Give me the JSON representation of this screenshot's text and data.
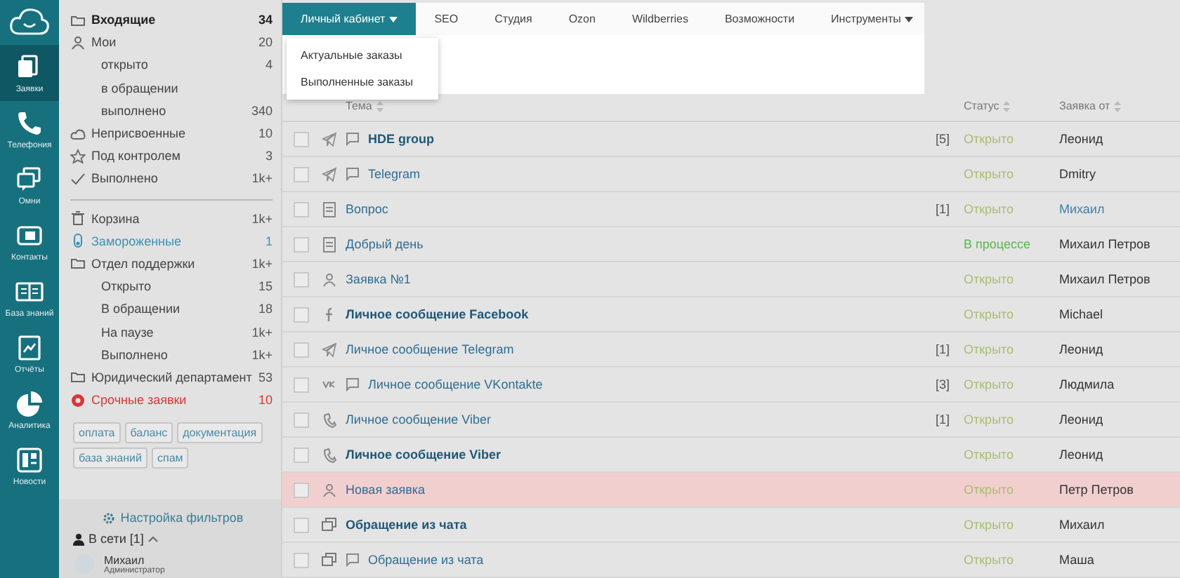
{
  "rail": {
    "items": [
      {
        "kind": "requests",
        "label": "Заявки",
        "selected": true
      },
      {
        "kind": "phone",
        "label": "Телефония",
        "selected": false
      },
      {
        "kind": "omni",
        "label": "Омни",
        "selected": false
      },
      {
        "kind": "contacts",
        "label": "Контакты",
        "selected": false
      },
      {
        "kind": "book",
        "label": "База знаний",
        "selected": false
      },
      {
        "kind": "report",
        "label": "Отчёты",
        "selected": false
      },
      {
        "kind": "pie",
        "label": "Аналитика",
        "selected": false
      },
      {
        "kind": "news",
        "label": "Новости",
        "selected": false
      }
    ]
  },
  "sidebar": {
    "sections": [
      {
        "items": [
          {
            "kind": "folder",
            "label": "Входящие",
            "count": "34",
            "bold": true
          },
          {
            "kind": "user",
            "label": "Мои",
            "count": "20",
            "bold": false,
            "children": [
              {
                "label": "открыто",
                "count": "4",
                "bold": false
              },
              {
                "label": "в обращении",
                "bold": false
              },
              {
                "label": "выполнено",
                "count": "340",
                "bold": false
              }
            ]
          },
          {
            "kind": "cloud",
            "label": "Неприсвоенные",
            "count": "10",
            "bold": false
          },
          {
            "kind": "star",
            "label": "Под контролем",
            "count": "3",
            "bold": false
          },
          {
            "kind": "check",
            "label": "Выполнено",
            "count": "1k+",
            "bold": false
          }
        ]
      },
      {
        "items": [
          {
            "kind": "trash",
            "label": "Корзина",
            "count": "1k+",
            "bold": false
          },
          {
            "kind": "frozen",
            "label": "Замороженные",
            "count": "1",
            "bold": false
          },
          {
            "kind": "folder",
            "label": "Отдел поддержки",
            "count": "1k+",
            "bold": false,
            "children": [
              {
                "label": "Открыто",
                "count": "15",
                "bold": false
              },
              {
                "label": "В обращении",
                "count": "18",
                "bold": false
              },
              {
                "label": "На паузе",
                "count": "1k+",
                "bold": false
              },
              {
                "label": "Выполнено",
                "count": "1k+",
                "bold": false
              }
            ]
          },
          {
            "kind": "folder",
            "label": "Юридический департамент",
            "count": "53",
            "bold": false
          },
          {
            "kind": "urgent",
            "label": "Срочные заявки",
            "count": "10",
            "bold": false
          }
        ]
      }
    ],
    "tags": [
      "оплата",
      "баланс",
      "документация",
      "база знаний",
      "спам"
    ],
    "filter_link": "Настройка фильтров",
    "online": {
      "label": "В сети [1]",
      "expanded": true
    },
    "user": {
      "name": "Михаил",
      "role": "Администратор"
    }
  },
  "nav": {
    "tabs": [
      {
        "label": "Личный кабинет",
        "selected": true,
        "dropdown": true
      },
      {
        "label": "SEO",
        "selected": false,
        "dropdown": false
      },
      {
        "label": "Студия",
        "selected": false,
        "dropdown": false
      },
      {
        "label": "Ozon",
        "selected": false,
        "dropdown": false
      },
      {
        "label": "Wildberries",
        "selected": false,
        "dropdown": false
      },
      {
        "label": "Возможности",
        "selected": false,
        "dropdown": false
      },
      {
        "label": "Инструменты",
        "selected": false,
        "dropdown": true
      }
    ],
    "menu": [
      "Актуальные заказы",
      "Выполненные заказы"
    ]
  },
  "table": {
    "columns": [
      {
        "label": "Тема"
      },
      {
        "label": "Статус"
      },
      {
        "label": "Заявка от"
      }
    ],
    "rows": [
      {
        "kind": "telegram",
        "comment": true,
        "title": "HDE group",
        "bold": true,
        "count": "[5]",
        "status": "Открыто",
        "in_progress": false,
        "author": "Леонид",
        "author_link": false,
        "highlighted": false,
        "checked": false
      },
      {
        "kind": "telegram",
        "comment": true,
        "title": "Telegram",
        "bold": false,
        "status": "Открыто",
        "in_progress": false,
        "author": "Dmitry",
        "author_link": false,
        "highlighted": false,
        "checked": false
      },
      {
        "kind": "document",
        "comment": false,
        "title": "Вопрос",
        "bold": false,
        "count": "[1]",
        "status": "Открыто",
        "in_progress": false,
        "author": "Михаил",
        "author_link": true,
        "highlighted": false,
        "checked": false
      },
      {
        "kind": "document",
        "comment": false,
        "title": "Добрый день",
        "bold": false,
        "status": "В процессе",
        "in_progress": true,
        "author": "Михаил Петров",
        "author_link": false,
        "highlighted": false,
        "checked": false
      },
      {
        "kind": "user",
        "comment": false,
        "title": "Заявка №1",
        "bold": false,
        "status": "Открыто",
        "in_progress": false,
        "author": "Михаил Петров",
        "author_link": false,
        "highlighted": false,
        "checked": false
      },
      {
        "kind": "facebook",
        "comment": false,
        "title": "Личное сообщение Facebook",
        "bold": true,
        "status": "Открыто",
        "in_progress": false,
        "author": "Michael",
        "author_link": false,
        "highlighted": false,
        "checked": false
      },
      {
        "kind": "telegram",
        "comment": false,
        "title": "Личное сообщение Telegram",
        "bold": false,
        "count": "[1]",
        "status": "Открыто",
        "in_progress": false,
        "author": "Леонид",
        "author_link": false,
        "highlighted": false,
        "checked": false
      },
      {
        "kind": "vk",
        "comment": true,
        "title": "Личное сообщение VKontakte",
        "bold": false,
        "count": "[3]",
        "status": "Открыто",
        "in_progress": false,
        "author": "Людмила",
        "author_link": false,
        "highlighted": false,
        "checked": false
      },
      {
        "kind": "viber",
        "comment": false,
        "title": "Личное сообщение Viber",
        "bold": false,
        "count": "[1]",
        "status": "Открыто",
        "in_progress": false,
        "author": "Леонид",
        "author_link": false,
        "highlighted": false,
        "checked": false
      },
      {
        "kind": "viber",
        "comment": false,
        "title": "Личное сообщение Viber",
        "bold": true,
        "status": "Открыто",
        "in_progress": false,
        "author": "Леонид",
        "author_link": false,
        "highlighted": false,
        "checked": false
      },
      {
        "kind": "user",
        "comment": false,
        "title": "Новая заявка",
        "bold": false,
        "status": "Открыто",
        "in_progress": false,
        "author": "Петр Петров",
        "author_link": false,
        "highlighted": true,
        "checked": false
      },
      {
        "kind": "chat",
        "comment": false,
        "title": "Обращение из чата",
        "bold": true,
        "status": "Открыто",
        "in_progress": false,
        "author": "Михаил",
        "author_link": false,
        "highlighted": false,
        "checked": false
      },
      {
        "kind": "chat",
        "comment": true,
        "title": "Обращение из чата",
        "bold": false,
        "status": "Открыто",
        "in_progress": false,
        "author": "Маша",
        "author_link": false,
        "highlighted": false,
        "checked": false
      }
    ]
  }
}
